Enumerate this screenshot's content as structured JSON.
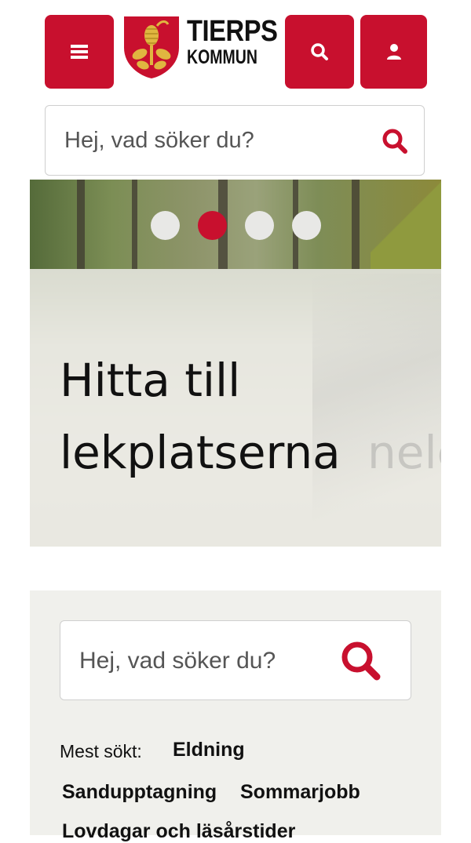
{
  "header": {
    "logo_line1": "TIERPS",
    "logo_line2": "KOMMUN",
    "menu_icon": "hamburger-icon",
    "search_icon": "search-icon",
    "user_icon": "user-icon"
  },
  "colors": {
    "brand_red": "#c8102e",
    "panel_bg": "#f0f0ec",
    "text": "#111111"
  },
  "search_top": {
    "placeholder": "Hej, vad söker du?"
  },
  "hero": {
    "title_line1": "Hitta till",
    "title_line2": "lekplatserna",
    "ghost_text": "nele",
    "slides_total": 4,
    "active_slide": 2
  },
  "search_bottom": {
    "placeholder": "Hej, vad söker du?"
  },
  "popular": {
    "label": "Mest sökt:",
    "items": [
      "Eldning",
      "Sandupptagning",
      "Sommarjobb",
      "Lovdagar och läsårstider"
    ]
  }
}
